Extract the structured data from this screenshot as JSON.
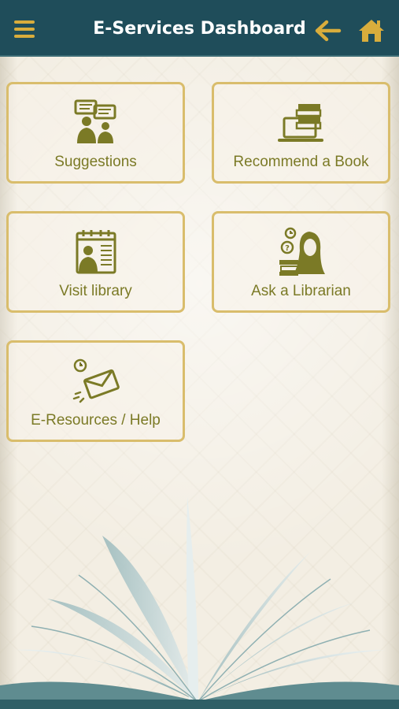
{
  "header": {
    "title": "E-Services Dashboard",
    "menu_icon": "hamburger-menu-icon",
    "back_icon": "arrow-left-icon",
    "home_icon": "home-icon"
  },
  "tiles": [
    {
      "label": "Suggestions",
      "icon": "suggestions-chat-icon"
    },
    {
      "label": "Recommend a Book",
      "icon": "books-laptop-icon"
    },
    {
      "label": "Visit library",
      "icon": "calendar-visit-icon"
    },
    {
      "label": "Ask a Librarian",
      "icon": "librarian-question-icon"
    },
    {
      "label": "E-Resources / Help",
      "icon": "envelope-clock-icon"
    }
  ],
  "colors": {
    "header_bg": "#1f4d5a",
    "accent_gold": "#d9ad3c",
    "tile_border": "#d9bd6c",
    "tile_text": "#7b7a26",
    "background": "#f3eee3"
  }
}
